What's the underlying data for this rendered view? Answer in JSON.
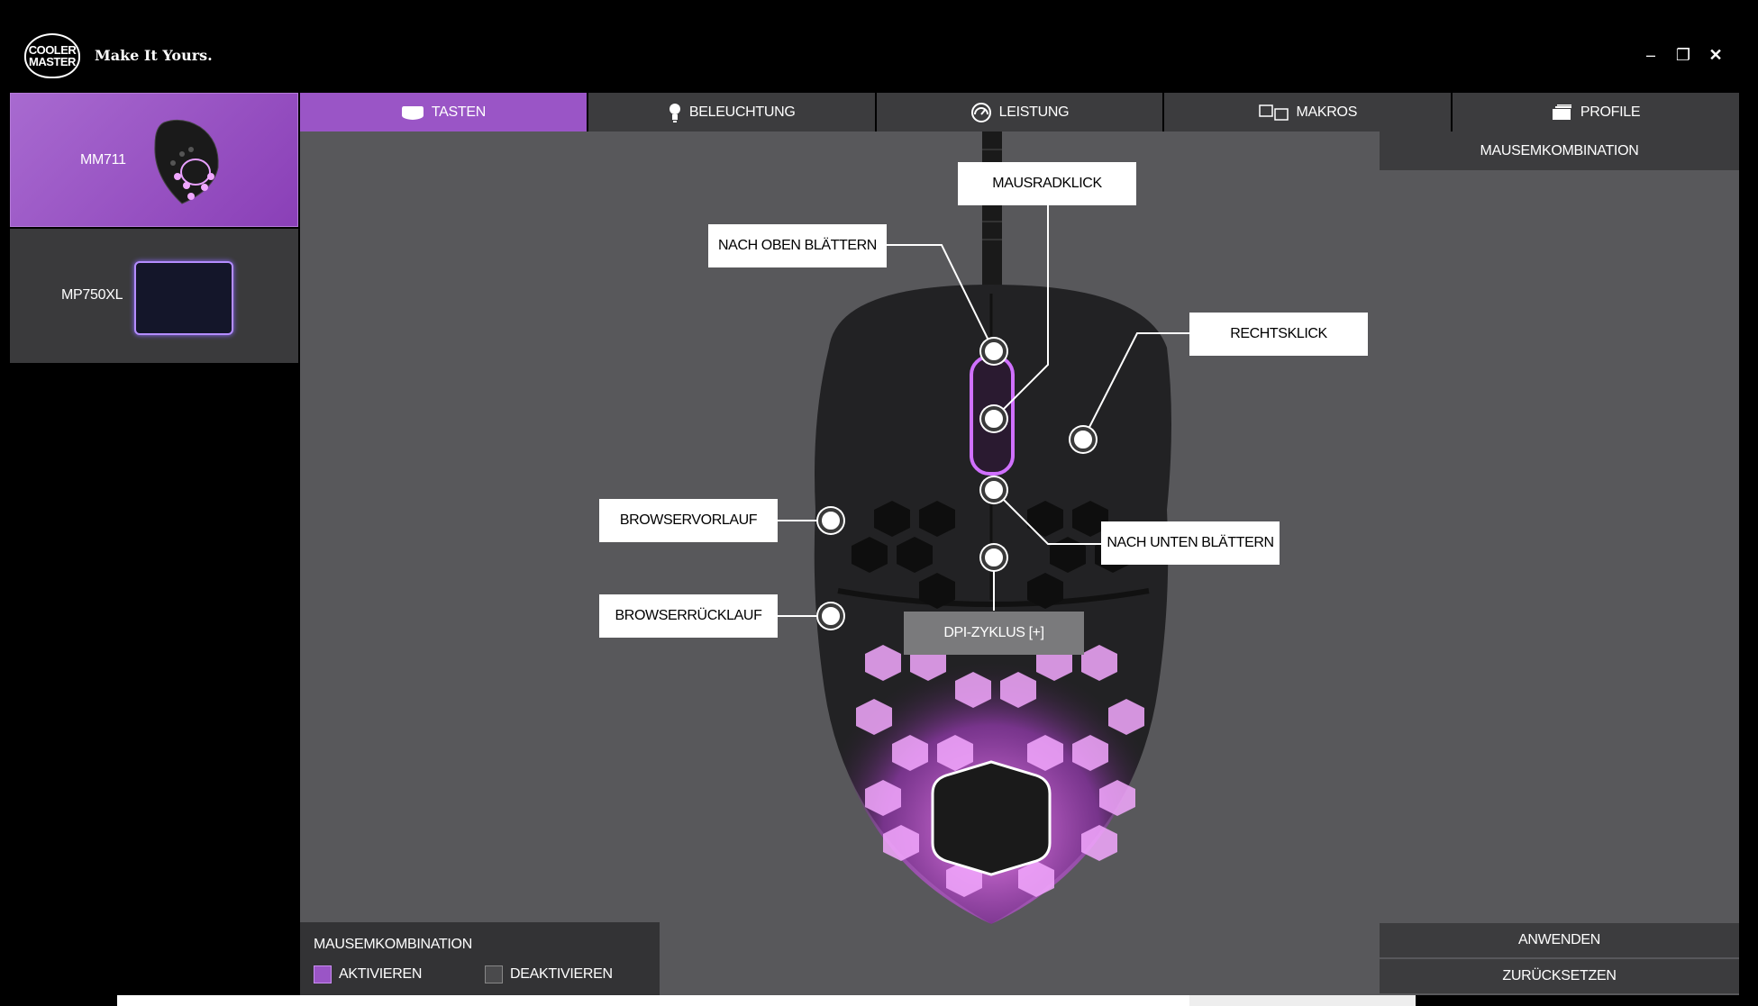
{
  "app": {
    "logo_line1": "COOLER",
    "logo_line2": "MASTER",
    "tagline": "Make It Yours.",
    "window_controls": {
      "minimize": "–",
      "restore": "❐",
      "close": "✕"
    }
  },
  "devices": [
    {
      "name": "MM711",
      "active": true
    },
    {
      "name": "MP750XL",
      "active": false
    }
  ],
  "tabs": [
    {
      "label": "TASTEN",
      "icon": "mouse-top-icon",
      "active": true
    },
    {
      "label": "BELEUCHTUNG",
      "icon": "light-bulb-icon",
      "active": false
    },
    {
      "label": "LEISTUNG",
      "icon": "gauge-icon",
      "active": false
    },
    {
      "label": "MAKROS",
      "icon": "macro-keys-icon",
      "active": false
    },
    {
      "label": "PROFILE",
      "icon": "profile-cards-icon",
      "active": false
    }
  ],
  "right_panel": {
    "title": "MAUSEMKOMBINATION"
  },
  "button_labels": {
    "wheel_click": "MAUSRADKLICK",
    "scroll_up": "NACH OBEN BLÄTTERN",
    "right_click": "RECHTSKLICK",
    "browser_back": "BROWSERVORLAUF",
    "scroll_down": "NACH UNTEN BLÄTTERN",
    "browser_forward": "BROWSERRÜCKLAUF",
    "dpi_cycle": "DPI-ZYKLUS [+]"
  },
  "combo": {
    "title": "MAUSEMKOMBINATION",
    "enable_label": "AKTIVIEREN",
    "disable_label": "DEAKTIVIEREN",
    "selected": "AKTIVIEREN"
  },
  "actions": {
    "apply": "ANWENDEN",
    "reset": "ZURÜCKSETZEN"
  },
  "colors": {
    "accent": "#9a55c6",
    "panel": "#58585b",
    "tab": "#3c3c3e",
    "glow": "#e070ff"
  }
}
